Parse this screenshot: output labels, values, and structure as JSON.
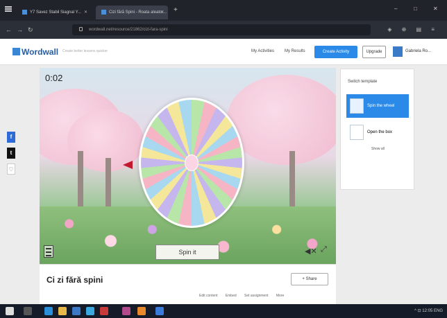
{
  "browser": {
    "tabs": [
      {
        "label": "Y7 Savez Stabil Siagnal Y..."
      },
      {
        "label": "Cizi fără Spini - Roata aleator..."
      }
    ],
    "new_tab": "+",
    "url": "wordwall.net/resource/21862/cizi-fara-spini",
    "window_controls": [
      "–",
      "□",
      "✕"
    ]
  },
  "site": {
    "logo": "Wordwall",
    "tagline": "Create better lessons quicker",
    "nav": {
      "my_activities": "My Activities",
      "my_results": "My Results",
      "create": "Create Activity",
      "upgrade": "Upgrade",
      "user": "Gabriela Ro..."
    }
  },
  "share_rail": {
    "fb": "f",
    "tw": "t",
    "fav": "♡"
  },
  "game": {
    "timer": "0:02",
    "spin_label": "Spin it",
    "sound_icon": "speaker-mute-icon",
    "fullscreen_icon": "fullscreen-icon",
    "menu_icon": "menu-icon"
  },
  "activity": {
    "title": "Ci zi fără spini",
    "share_label": "+ Share",
    "actions": [
      "Edit content",
      "Embed",
      "Set assignment",
      "More"
    ]
  },
  "switch_template": {
    "title": "Switch template",
    "items": [
      {
        "label": "Spin the wheel",
        "active": true
      },
      {
        "label": "Open the box",
        "active": false
      }
    ],
    "show_all": "Show all"
  },
  "taskbar": {
    "apps": [
      "windows-icon",
      "search-icon",
      "edge-icon",
      "files-icon",
      "store-icon",
      "chrome-icon",
      "opera-icon",
      "app-icon",
      "vlc-icon",
      "mail-icon"
    ],
    "tray": "^ ⊡ 12:05 ENG"
  }
}
